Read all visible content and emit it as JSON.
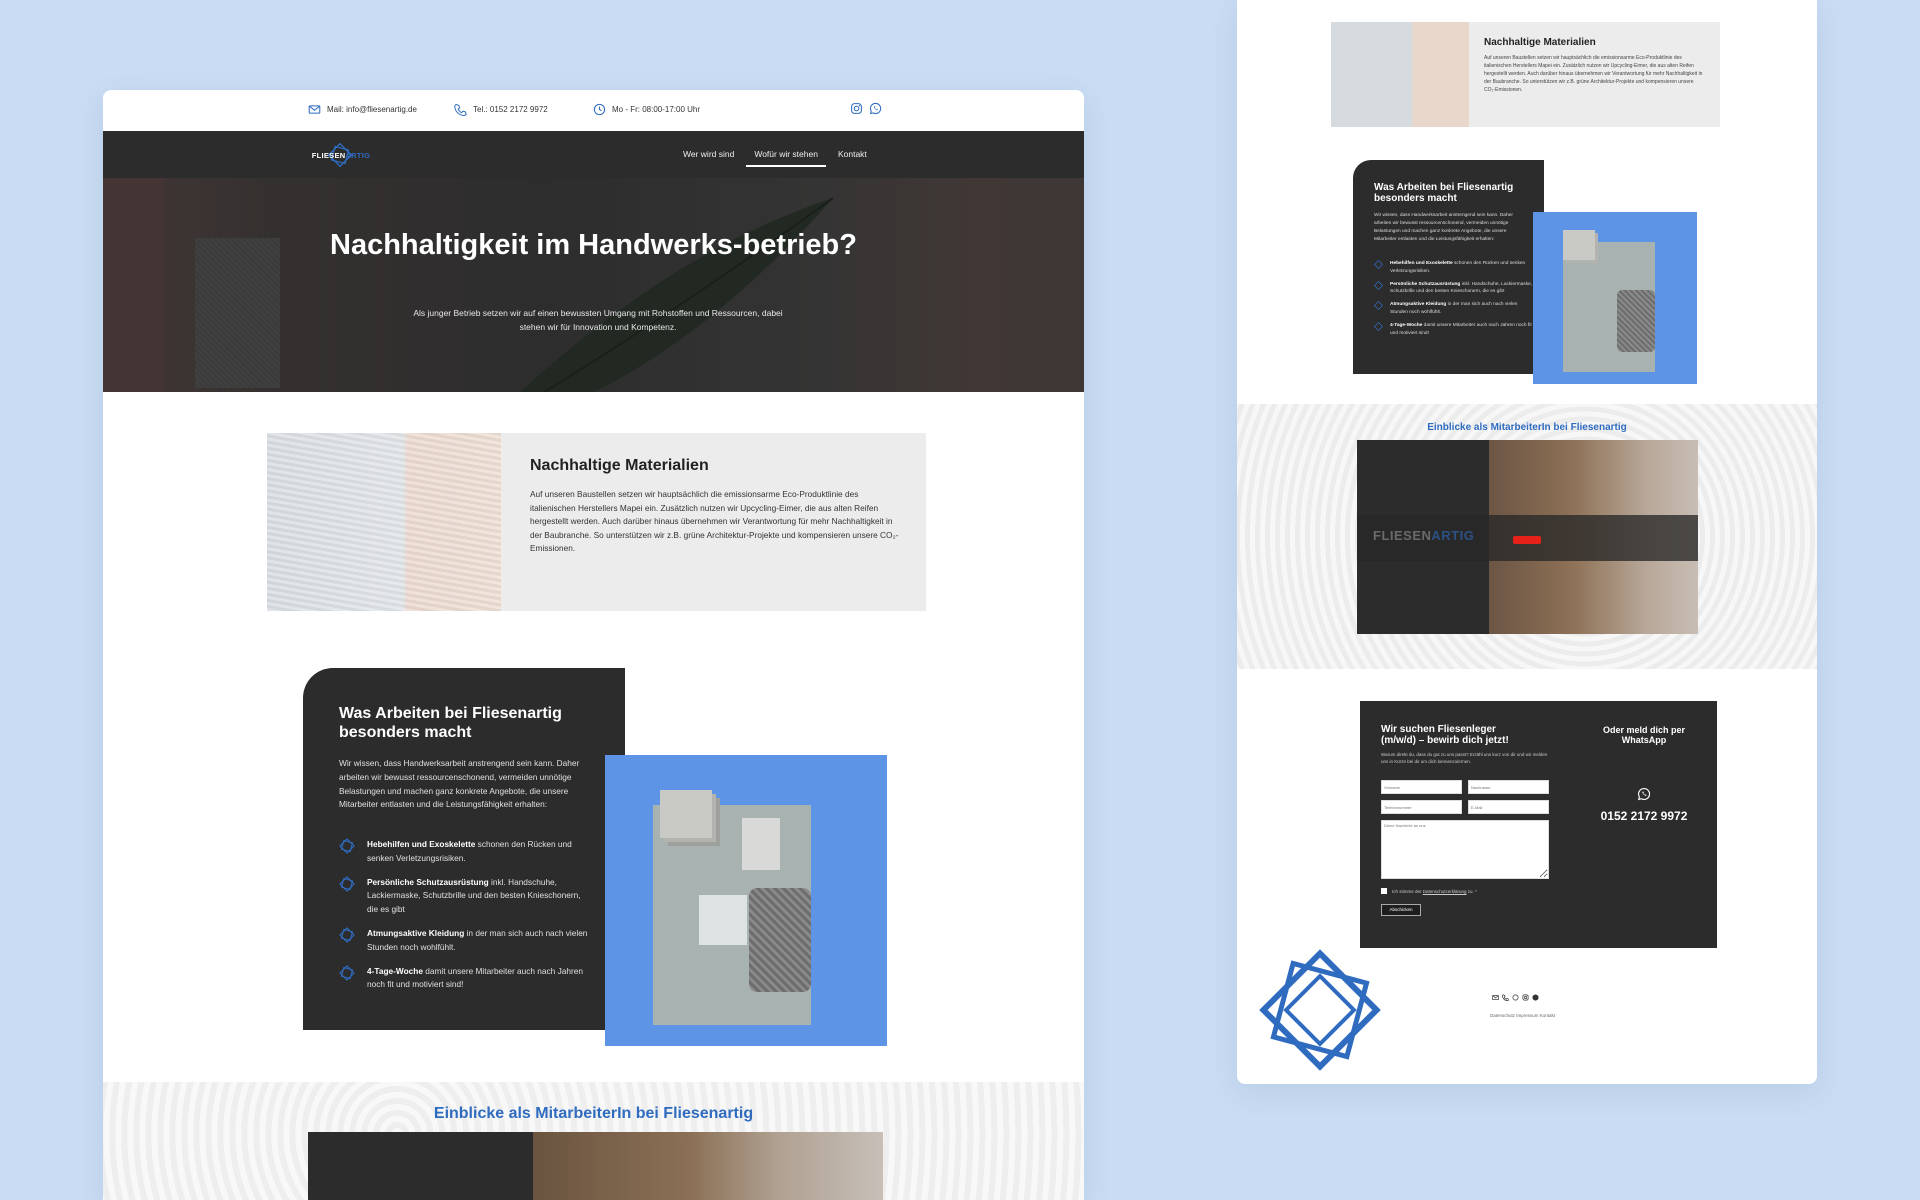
{
  "topbar": {
    "mail": "Mail: info@fliesenartig.de",
    "phone": "Tel.: 0152 2172 9972",
    "hours": "Mo - Fr: 08:00-17:00 Uhr"
  },
  "logo": {
    "part1": "FLIESEN",
    "part2": "ARTIG"
  },
  "nav": {
    "items": [
      {
        "label": "Wer wird sind"
      },
      {
        "label": "Wofür wir stehen"
      },
      {
        "label": "Kontakt"
      }
    ],
    "active_index": 1
  },
  "hero": {
    "title": "Nachhaltigkeit im Handwerks-betrieb?",
    "text": "Als junger Betrieb setzen wir auf einen bewussten Umgang mit Rohstoffen und Ressourcen, dabei stehen wir für Innovation und Kompetenz."
  },
  "materials": {
    "title": "Nachhaltige Materialien",
    "text": "Auf unseren Baustellen setzen wir hauptsächlich die emissionsarme Eco-Produktlinie des italienischen Herstellers Mapei ein. Zusätzlich nutzen wir Upcycling-Eimer, die aus alten Reifen hergestellt werden. Auch darüber hinaus übernehmen wir Verantwortung für mehr Nachhaltigkeit in der Baubranche. So unterstützen wir z.B. grüne Architektur-Projekte und kompensieren unsere CO₂-Emissionen."
  },
  "work": {
    "title": "Was Arbeiten bei Fliesenartig besonders macht",
    "text": "Wir wissen, dass Handwerksarbeit anstrengend sein kann. Daher arbeiten wir bewusst ressourcenschonend, vermeiden unnötige Belastungen und machen ganz konkrete Angebote, die unsere Mitarbeiter entlasten und die Leistungsfähigkeit erhalten:",
    "items": [
      {
        "bold": "Hebehilfen und Exoskelette",
        "rest": " schonen den Rücken und senken Verletzungsrisiken."
      },
      {
        "bold": "Persönliche Schutzausrüstung",
        "rest": " inkl. Handschuhe, Lackiermaske, Schutzbrille und den besten Knieschonern, die es gibt"
      },
      {
        "bold": "Atmungsaktive Kleidung",
        "rest": " in der man sich auch nach vielen Stunden noch wohlfühlt."
      },
      {
        "bold": "4-Tage-Woche",
        "rest": " damit unsere Mitarbeiter auch nach Jahren noch fit und motiviert sind!"
      }
    ]
  },
  "insights": {
    "title": "Einblicke als MitarbeiterIn bei Fliesenartig"
  },
  "right": {
    "materials": {
      "title": "Nachhaltige Materialien",
      "text": "Auf unseren Baustellen setzen wir hauptsächlich die emissionsarme Eco-Produktlinie des italienischen Herstellers Mapei ein. Zusätzlich nutzen wir Upcycling-Eimer, die aus alten Reifen hergestellt werden. Auch darüber hinaus übernehmen wir Verantwortung für mehr Nachhaltigkeit in der Baubranche. So unterstützen wir z.B. grüne Architektur-Projekte und kompensieren unsere CO₂-Emissionen."
    },
    "work": {
      "title": "Was Arbeiten bei Fliesenartig besonders macht",
      "text": "Wir wissen, dass Handwerksarbeit anstrengend sein kann. Daher arbeiten wir bewusst ressourcenschonend, vermeiden unnötige Belastungen und machen ganz konkrete Angebote, die unsere Mitarbeiter entlasten und die Leistungsfähigkeit erhalten:"
    },
    "insights_title": "Einblicke als MitarbeiterIn bei Fliesenartig",
    "video": {
      "logo1": "FLIESEN",
      "logo2": "ARTIG"
    },
    "form": {
      "title": "Wir suchen Fliesenleger (m/w/d) – bewirb dich jetzt!",
      "text": "Warum direkt du, dass du gut zu uns passt? Erzähl uns kurz von dir und wir melden uns in Kürze bei dir um dich kennenzulernen.",
      "firstname": "Vorname",
      "lastname": "Nachname",
      "phone": "Telefonnummer",
      "email": "E-Mail",
      "message": "Deine Nachricht an uns",
      "consent_pre": "Ich stimme der ",
      "consent_link": "Datenschutzerklärung",
      "consent_post": " zu. *",
      "submit": "Abschicken"
    },
    "whatsapp": {
      "title": "Oder meld dich per WhatsApp",
      "phone": "0152 2172 9972"
    },
    "footer_links": "Datenschutz  Impressum  Kontakt"
  },
  "colors": {
    "brand_blue": "#2f6cc0",
    "dark": "#2c2c2c",
    "background": "#c9dcf3"
  }
}
